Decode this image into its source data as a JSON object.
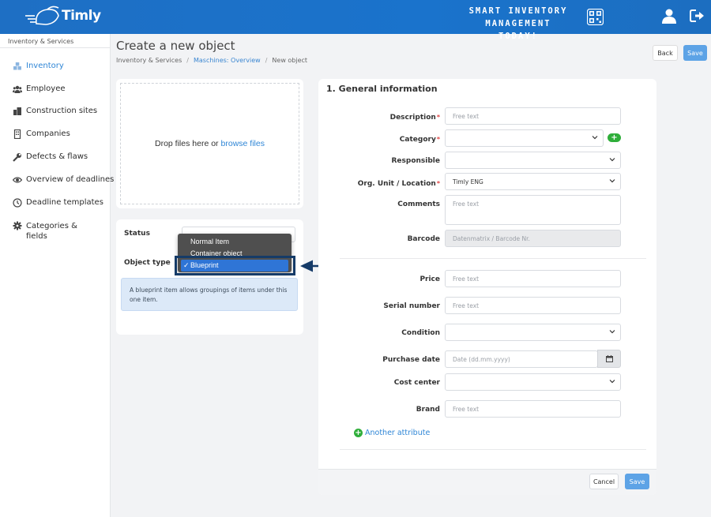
{
  "header": {
    "brand": "Timly",
    "slogan_line1": "SMART INVENTORY",
    "slogan_line2": "MANAGEMENT TODAY!",
    "icons": [
      "qr-code-icon",
      "user-icon",
      "logout-icon"
    ]
  },
  "sidebar": {
    "section": "Inventory & Services",
    "items": [
      {
        "label": "Inventory",
        "icon": "cubes-icon",
        "active": true
      },
      {
        "label": "Employee",
        "icon": "users-icon"
      },
      {
        "label": "Construction sites",
        "icon": "buildings-icon"
      },
      {
        "label": "Companies",
        "icon": "building-icon"
      },
      {
        "label": "Defects & flaws",
        "icon": "wrench-icon"
      },
      {
        "label": "Overview of deadlines",
        "icon": "eye-icon"
      },
      {
        "label": "Deadline templates",
        "icon": "clock-icon"
      },
      {
        "label": "Categories & fields",
        "icon": "gear-icon"
      }
    ]
  },
  "page": {
    "title": "Create a new object",
    "breadcrumb": [
      "Inventory & Services",
      "Maschines: Overview",
      "New object"
    ],
    "back_label": "Back",
    "save_label": "Save"
  },
  "upload": {
    "text": "Drop files here or",
    "link": "browse files"
  },
  "status_card": {
    "status_label": "Status",
    "object_type_label": "Object type",
    "menu_options": [
      "Normal Item",
      "Container object",
      "Blueprint"
    ],
    "selected_option": "Blueprint",
    "check": "✓",
    "info": "A blueprint item allows groupings of items under this one item."
  },
  "form": {
    "section_title": "1. General information",
    "fields": {
      "description": {
        "label": "Description",
        "placeholder": "Free text"
      },
      "category": {
        "label": "Category"
      },
      "responsible": {
        "label": "Responsible"
      },
      "org_unit": {
        "label": "Org. Unit / Location",
        "value": "Timly ENG"
      },
      "comments": {
        "label": "Comments",
        "placeholder": "Free text"
      },
      "barcode": {
        "label": "Barcode",
        "placeholder": "Datenmatrix / Barcode Nr."
      },
      "price": {
        "label": "Price",
        "placeholder": "Free text"
      },
      "serial": {
        "label": "Serial number",
        "placeholder": "Free text"
      },
      "condition": {
        "label": "Condition"
      },
      "purchase_date": {
        "label": "Purchase date",
        "placeholder": "Date (dd.mm.yyyy)"
      },
      "cost_center": {
        "label": "Cost center"
      },
      "brand": {
        "label": "Brand",
        "placeholder": "Free text"
      }
    },
    "required_mark": "*",
    "add_symbol": "+",
    "another_attribute": "Another attribute",
    "cancel_label": "Cancel",
    "save_label": "Save"
  },
  "colors": {
    "header_blue": "#1a73cc",
    "link_blue": "#2f86d6",
    "save_blue": "#5da3e6",
    "add_green": "#2fae3a",
    "menu_selected": "#2f75d6",
    "arrow_navy": "#153b68"
  }
}
